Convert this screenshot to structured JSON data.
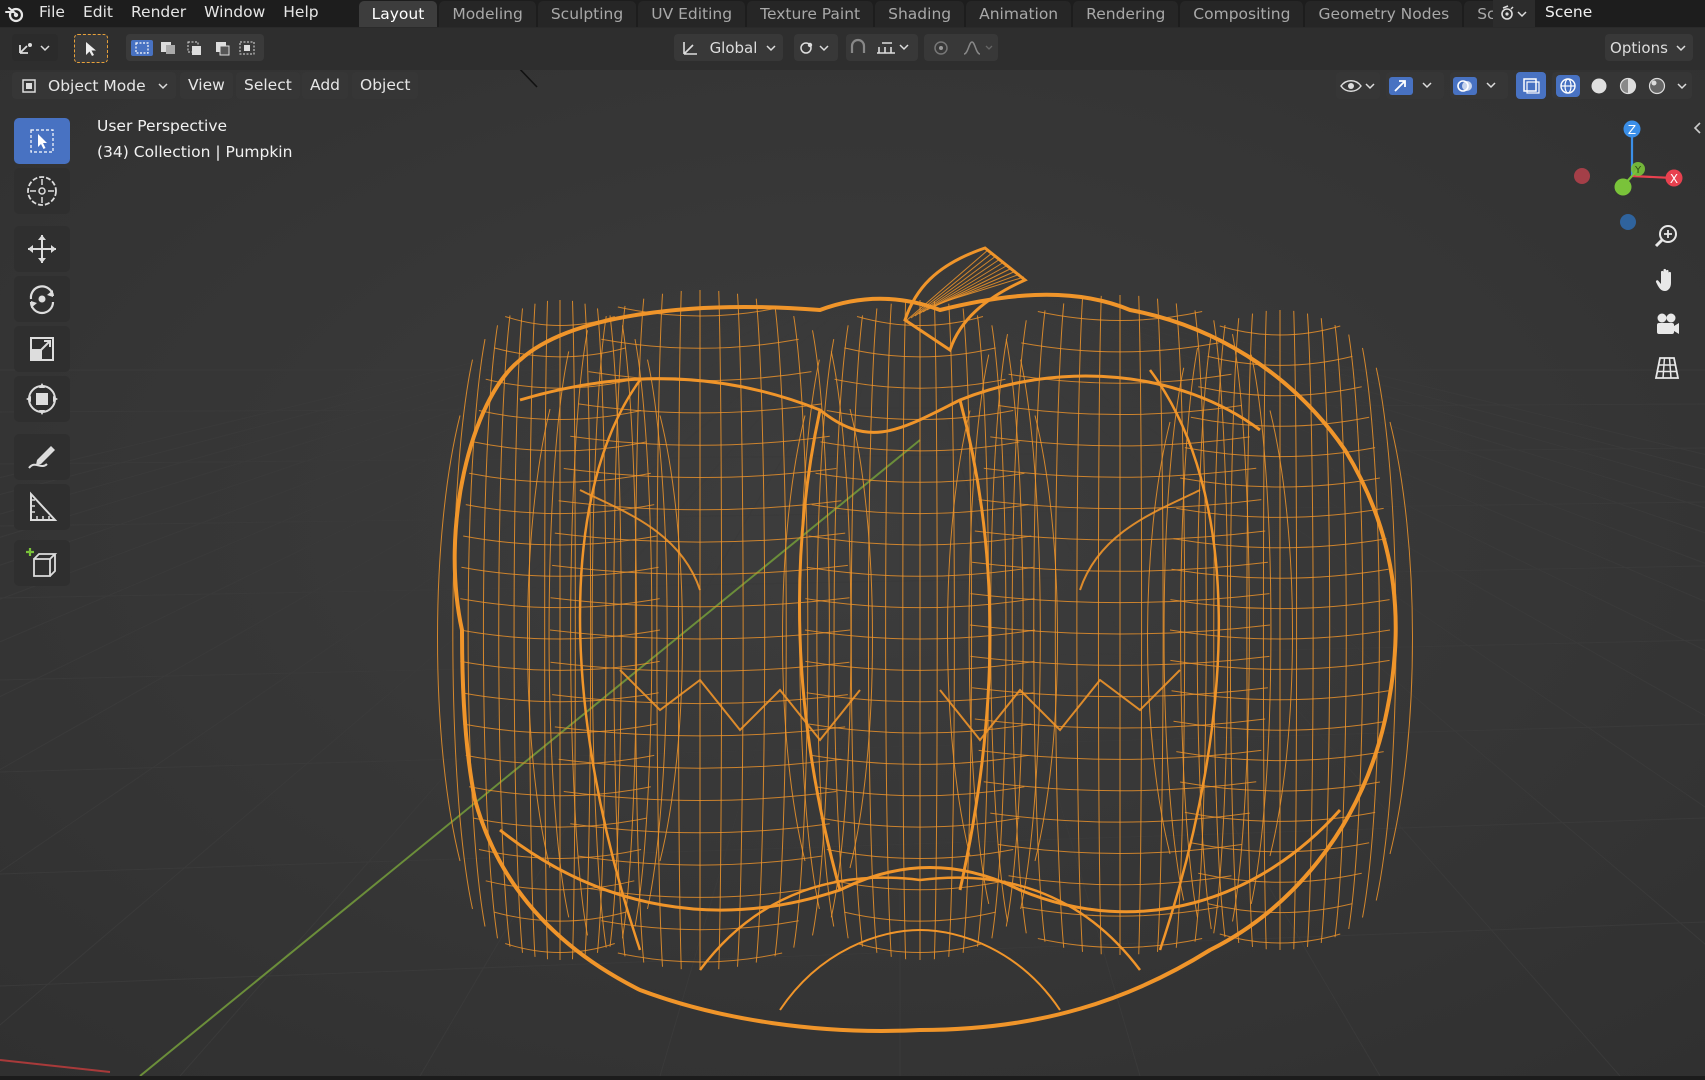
{
  "topbar": {
    "menus": [
      "File",
      "Edit",
      "Render",
      "Window",
      "Help"
    ],
    "workspaces": [
      "Layout",
      "Modeling",
      "Sculpting",
      "UV Editing",
      "Texture Paint",
      "Shading",
      "Animation",
      "Rendering",
      "Compositing",
      "Geometry Nodes",
      "Scripting"
    ],
    "active_workspace": "Layout",
    "scene_name": "Scene"
  },
  "toolheader": {
    "orientation_label": "Global",
    "options_label": "Options"
  },
  "viewport_header": {
    "mode_label": "Object Mode",
    "menus": [
      "View",
      "Select",
      "Add",
      "Object"
    ]
  },
  "viewport": {
    "view_name": "User Perspective",
    "object_info": "(34) Collection | Pumpkin",
    "wire_color": "#f0952a",
    "grid_color": "#3a3a3a",
    "axis_y_color": "#6a9a3a",
    "axis_x_color": "#b03a3a"
  },
  "gizmo": {
    "z_label": "Z",
    "y_label": "Y",
    "x_label": "X",
    "x_color": "#e8414f",
    "y_color": "#7ac33a",
    "z_color": "#3b8fe8"
  },
  "tools": [
    "select-box",
    "cursor",
    "move",
    "rotate",
    "scale",
    "transform",
    "annotate",
    "measure",
    "add-cube"
  ]
}
